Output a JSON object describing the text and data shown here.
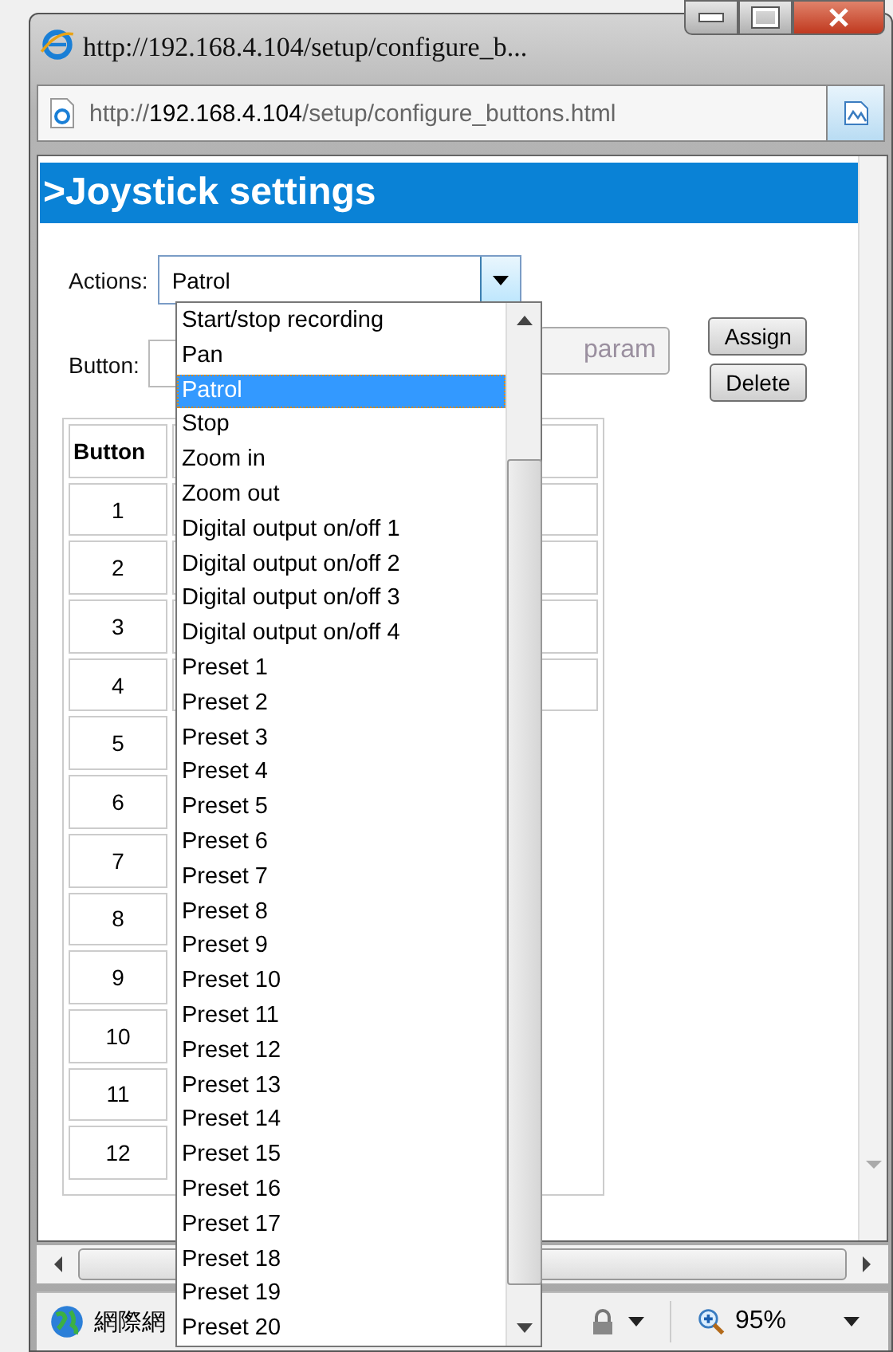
{
  "window": {
    "title": "http://192.168.4.104/setup/configure_b..."
  },
  "address_bar": {
    "prefix": "http://",
    "host": "192.168.4.104",
    "path": "/setup/configure_buttons.html"
  },
  "page": {
    "heading": ">Joystick settings",
    "actions": {
      "label": "Actions:",
      "value": "Patrol",
      "expanded": true,
      "options": [
        {
          "label": "Start/stop recording",
          "selected": false
        },
        {
          "label": "Pan",
          "selected": false
        },
        {
          "label": "Patrol",
          "selected": true
        },
        {
          "label": "Stop",
          "selected": false
        },
        {
          "label": "Zoom in",
          "selected": false
        },
        {
          "label": "Zoom out",
          "selected": false
        },
        {
          "label": "Digital output on/off 1",
          "selected": false
        },
        {
          "label": "Digital output on/off 2",
          "selected": false
        },
        {
          "label": "Digital output on/off 3",
          "selected": false
        },
        {
          "label": "Digital output on/off 4",
          "selected": false
        },
        {
          "label": "Preset 1",
          "selected": false
        },
        {
          "label": "Preset 2",
          "selected": false
        },
        {
          "label": "Preset 3",
          "selected": false
        },
        {
          "label": "Preset 4",
          "selected": false
        },
        {
          "label": "Preset 5",
          "selected": false
        },
        {
          "label": "Preset 6",
          "selected": false
        },
        {
          "label": "Preset 7",
          "selected": false
        },
        {
          "label": "Preset 8",
          "selected": false
        },
        {
          "label": "Preset 9",
          "selected": false
        },
        {
          "label": "Preset 10",
          "selected": false
        },
        {
          "label": "Preset 11",
          "selected": false
        },
        {
          "label": "Preset 12",
          "selected": false
        },
        {
          "label": "Preset 13",
          "selected": false
        },
        {
          "label": "Preset 14",
          "selected": false
        },
        {
          "label": "Preset 15",
          "selected": false
        },
        {
          "label": "Preset 16",
          "selected": false
        },
        {
          "label": "Preset 17",
          "selected": false
        },
        {
          "label": "Preset 18",
          "selected": false
        },
        {
          "label": "Preset 19",
          "selected": false
        },
        {
          "label": "Preset 20",
          "selected": false
        }
      ]
    },
    "button_field": {
      "label": "Button:"
    },
    "param_button": "param",
    "assign_button": "Assign",
    "delete_button": "Delete",
    "table": {
      "columns": [
        "Button"
      ],
      "rows": [
        "1",
        "2",
        "3",
        "4",
        "5",
        "6",
        "7",
        "8",
        "9",
        "10",
        "11",
        "12"
      ]
    }
  },
  "status_bar": {
    "zone": "網際網",
    "zoom": "95%"
  }
}
